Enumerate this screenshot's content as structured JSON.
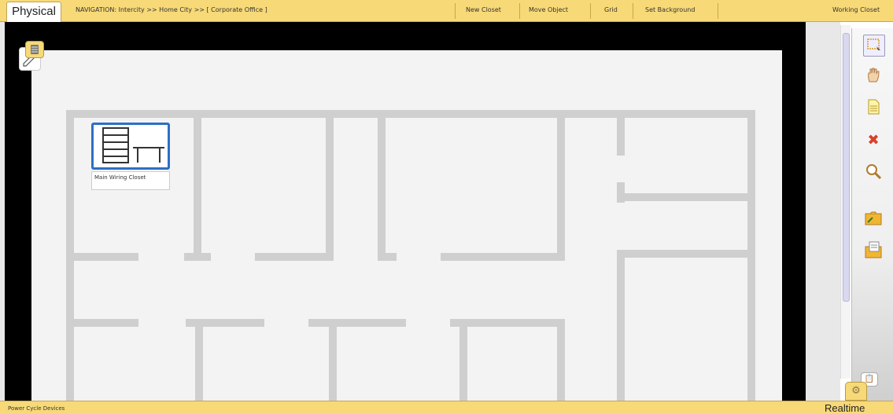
{
  "tabs": {
    "physical": "Physical",
    "realtime": "Realtime"
  },
  "toolbar": {
    "navigation": "NAVIGATION:  Intercity  >>   Home City  >>   [ Corporate Office ]",
    "new_closet": "New Closet",
    "move_object": "Move Object",
    "grid": "Grid",
    "set_background": "Set Background",
    "working_closet": "Working Closet"
  },
  "device": {
    "label": "Main Wiring Closet"
  },
  "status": {
    "text": "Power Cycle Devices"
  },
  "tools": [
    {
      "name": "select-icon",
      "glyph": "⬚"
    },
    {
      "name": "hand-icon",
      "glyph": "✋"
    },
    {
      "name": "note-icon",
      "glyph": "📄"
    },
    {
      "name": "delete-icon",
      "glyph": "✖"
    },
    {
      "name": "zoom-icon",
      "glyph": "🔍"
    },
    {
      "name": "folder-export-icon",
      "glyph": "📂"
    },
    {
      "name": "folder-note-icon",
      "glyph": "🗂"
    }
  ],
  "colors": {
    "toolbar": "#f7d977",
    "selection": "#2c6fc7",
    "wall": "#cfcfcf",
    "delete": "#d8402a"
  }
}
